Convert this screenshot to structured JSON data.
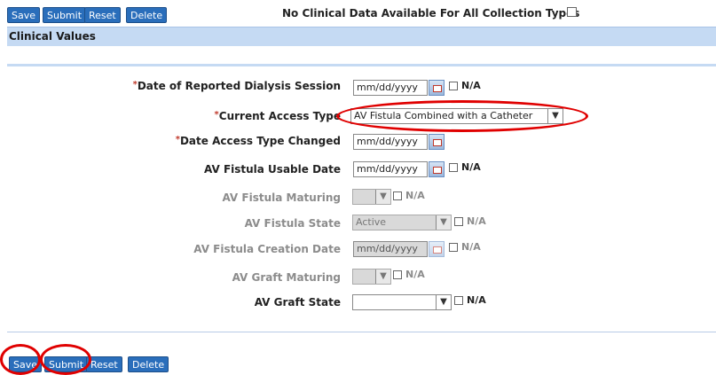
{
  "toolbar": {
    "save": "Save",
    "submit": "Submit",
    "reset": "Reset",
    "delete": "Delete"
  },
  "no_data_label": "No Clinical Data Available For All Collection Types",
  "section_title": "Clinical Values",
  "required_mark": "*",
  "na_label": "N/A",
  "fields": {
    "date_session": {
      "label": "Date of Reported Dialysis Session",
      "placeholder": "mm/dd/yyyy"
    },
    "current_access_type": {
      "label": "Current Access Type",
      "value": "AV Fistula Combined with a Catheter"
    },
    "date_access_changed": {
      "label": "Date Access Type Changed",
      "placeholder": "mm/dd/yyyy"
    },
    "av_fistula_usable_date": {
      "label": "AV Fistula Usable Date",
      "placeholder": "mm/dd/yyyy"
    },
    "av_fistula_maturing": {
      "label": "AV Fistula Maturing",
      "value": ""
    },
    "av_fistula_state": {
      "label": "AV Fistula State",
      "value": "Active"
    },
    "av_fistula_creation_date": {
      "label": "AV Fistula Creation Date",
      "placeholder": "mm/dd/yyyy"
    },
    "av_graft_maturing": {
      "label": "AV Graft Maturing",
      "value": ""
    },
    "av_graft_state": {
      "label": "AV Graft State",
      "value": ""
    }
  },
  "highlight_color": "#e00000",
  "accent_color": "#2a6ebb"
}
